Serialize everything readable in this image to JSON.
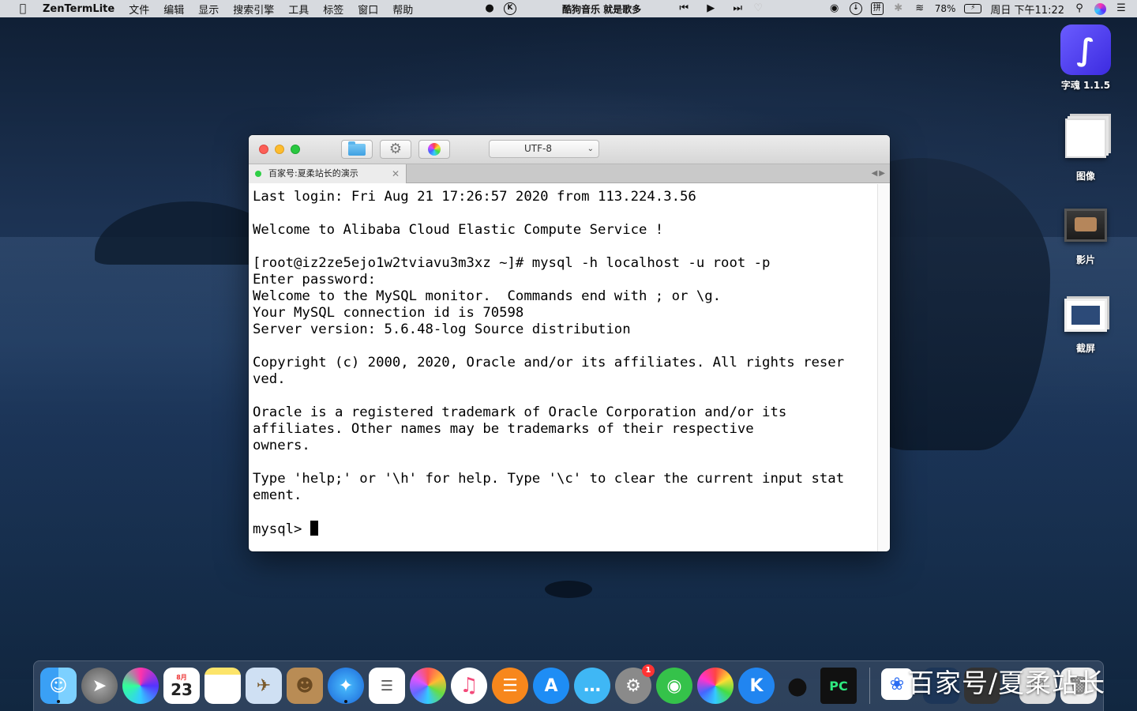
{
  "menubar": {
    "app_name": "ZenTermLite",
    "items": [
      "文件",
      "编辑",
      "显示",
      "搜索引擎",
      "工具",
      "标签",
      "窗口",
      "帮助"
    ],
    "now_playing": "酷狗音乐  就是歌多",
    "battery": "78%",
    "datetime": "周日 下午11:22"
  },
  "window": {
    "encoding": "UTF-8",
    "tab_title": "百家号:夏柔站长的演示",
    "terminal_lines": [
      "Last login: Fri Aug 21 17:26:57 2020 from 113.224.3.56",
      "",
      "Welcome to Alibaba Cloud Elastic Compute Service !",
      "",
      "[root@iz2ze5ejo1w2tviavu3m3xz ~]# mysql -h localhost -u root -p",
      "Enter password:",
      "Welcome to the MySQL monitor.  Commands end with ; or \\g.",
      "Your MySQL connection id is 70598",
      "Server version: 5.6.48-log Source distribution",
      "",
      "Copyright (c) 2000, 2020, Oracle and/or its affiliates. All rights reser",
      "ved.",
      "",
      "Oracle is a registered trademark of Oracle Corporation and/or its",
      "affiliates. Other names may be trademarks of their respective",
      "owners.",
      "",
      "Type 'help;' or '\\h' for help. Type '\\c' to clear the current input stat",
      "ement.",
      "",
      "mysql> "
    ]
  },
  "desktop": {
    "icons": [
      {
        "label": "字魂 1.1.5",
        "icon": "zihun-app-icon"
      },
      {
        "label": "图像",
        "icon": "image-stack-icon"
      },
      {
        "label": "影片",
        "icon": "movie-icon"
      },
      {
        "label": "截屏",
        "icon": "screenshot-icon"
      }
    ]
  },
  "dock": {
    "calendar_month": "8月",
    "calendar_day": "23",
    "settings_badge": "1"
  },
  "watermark": "百家号/夏柔站长"
}
